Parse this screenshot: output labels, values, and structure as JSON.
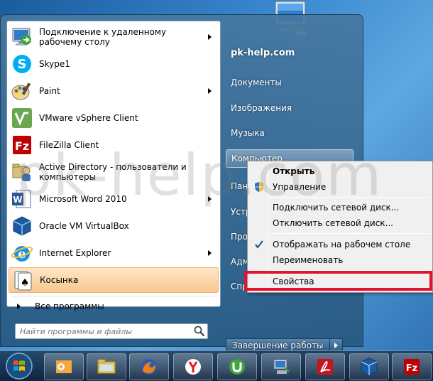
{
  "programs": [
    {
      "label": "Подключение к удаленному рабочему столу",
      "icon": "remote-desktop-icon",
      "submenu": true
    },
    {
      "label": "Skype1",
      "icon": "skype-icon",
      "submenu": false
    },
    {
      "label": "Paint",
      "icon": "paint-icon",
      "submenu": true
    },
    {
      "label": "VMware vSphere Client",
      "icon": "vmware-icon",
      "submenu": false
    },
    {
      "label": "FileZilla Client",
      "icon": "filezilla-icon",
      "submenu": false
    },
    {
      "label": "Active Directory - пользователи и компьютеры",
      "icon": "active-directory-icon",
      "submenu": false
    },
    {
      "label": "Microsoft Word 2010",
      "icon": "word-icon",
      "submenu": true
    },
    {
      "label": "Oracle VM VirtualBox",
      "icon": "virtualbox-icon",
      "submenu": false
    },
    {
      "label": "Internet Explorer",
      "icon": "ie-icon",
      "submenu": true
    },
    {
      "label": "Косынка",
      "icon": "solitaire-icon",
      "submenu": false
    }
  ],
  "all_programs": "Все программы",
  "search": {
    "placeholder": "Найти программы и файлы"
  },
  "right_pane": {
    "user": "pk-help.com",
    "items": [
      "Документы",
      "Изображения",
      "Музыка",
      "Компьютер",
      "Пане",
      "Устр",
      "Про",
      "Адм",
      "Спр"
    ]
  },
  "shutdown": {
    "label": "Завершение работы"
  },
  "context_menu": {
    "items": [
      "Открыть",
      "Управление",
      "Подключить сетевой диск...",
      "Отключить сетевой диск...",
      "Отображать на рабочем столе",
      "Переименовать",
      "Свойства"
    ]
  },
  "watermark": "pk-help.com",
  "taskbar": {
    "buttons": [
      "outlook-icon",
      "explorer-icon",
      "firefox-icon",
      "yandex-icon",
      "utorrent-icon",
      "network-icon",
      "acrobat-icon",
      "virtualbox-icon",
      "filezilla-icon"
    ]
  }
}
